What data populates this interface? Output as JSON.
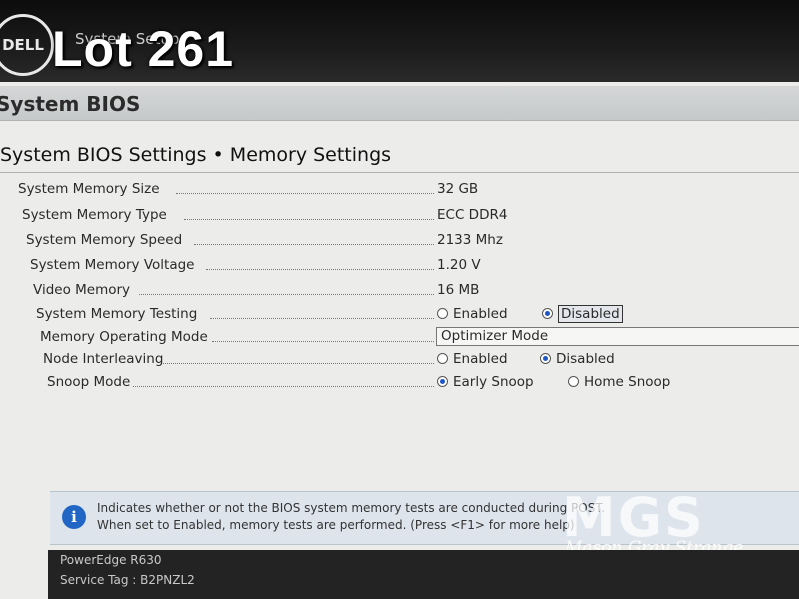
{
  "header": {
    "logo_text": "DELL",
    "app_title": "System Setup",
    "overlay_label": "Lot 261"
  },
  "bios": {
    "title": "System BIOS",
    "page_heading": "System BIOS Settings • Memory Settings"
  },
  "settings": {
    "memory_size": {
      "label": "System Memory Size",
      "value": "32 GB"
    },
    "memory_type": {
      "label": "System Memory Type",
      "value": "ECC DDR4"
    },
    "memory_speed": {
      "label": "System Memory Speed",
      "value": "2133 Mhz"
    },
    "memory_voltage": {
      "label": "System Memory Voltage",
      "value": "1.20 V"
    },
    "video_memory": {
      "label": "Video Memory",
      "value": "16 MB"
    },
    "memory_testing": {
      "label": "System Memory Testing",
      "options": [
        "Enabled",
        "Disabled"
      ],
      "selected": "Disabled"
    },
    "operating_mode": {
      "label": "Memory Operating Mode",
      "value": "Optimizer Mode"
    },
    "node_interleaving": {
      "label": "Node Interleaving",
      "options": [
        "Enabled",
        "Disabled"
      ],
      "selected": "Disabled"
    },
    "snoop_mode": {
      "label": "Snoop Mode",
      "options": [
        "Early Snoop",
        "Home Snoop"
      ],
      "selected": "Early Snoop"
    }
  },
  "help": {
    "line1": "Indicates whether or not the BIOS system memory tests are conducted during POST.",
    "line2": "When set to Enabled, memory tests are performed. (Press <F1> for more help)"
  },
  "footer": {
    "model": "PowerEdge R630",
    "service_tag": "Service Tag : B2PNZL2"
  },
  "watermark": {
    "logo": "MGS",
    "text": "Mason Gray Strange"
  },
  "colors": {
    "accent": "#1e55c8",
    "info_icon": "#2166c4",
    "screen_bg": "#ecedea",
    "title_bar": "#c9cccd",
    "footer_bg": "#232323"
  }
}
